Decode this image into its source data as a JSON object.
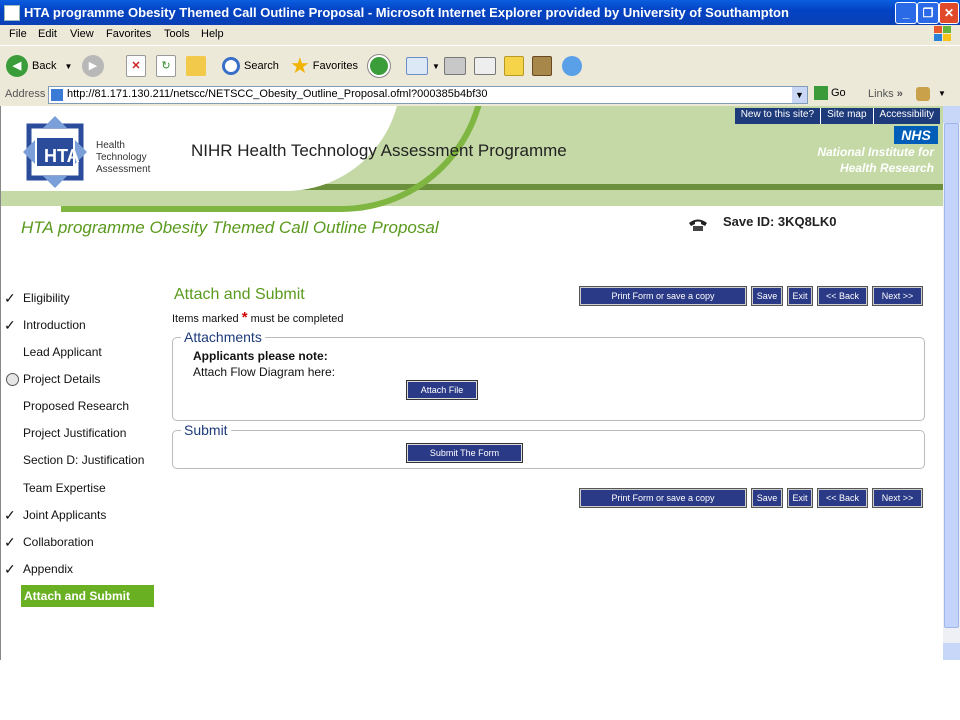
{
  "window": {
    "title": "HTA programme Obesity Themed Call Outline Proposal - Microsoft Internet Explorer provided by University of Southampton",
    "controls": {
      "minimize": "_",
      "maximize": "❐",
      "close": "✕"
    }
  },
  "menu": [
    "File",
    "Edit",
    "View",
    "Favorites",
    "Tools",
    "Help"
  ],
  "toolbar": {
    "back": "Back",
    "search": "Search",
    "favorites": "Favorites"
  },
  "address": {
    "label": "Address",
    "url": "http://81.171.130.211/netscc/NETSCC_Obesity_Outline_Proposal.ofml?000385b4bf30",
    "go": "Go",
    "links": "Links"
  },
  "banner": {
    "hta_logo_text": "HTA",
    "hta_line1": "Health",
    "hta_line2": "Technology",
    "hta_line3": "Assessment",
    "programme_title": "NIHR Health Technology Assessment Programme",
    "top_links": [
      "New to this site?",
      "Site map",
      "Accessibility"
    ],
    "nhs": "NHS",
    "nihr_line1": "National Institute for",
    "nihr_line2": "Health Research"
  },
  "page": {
    "proposal_title": "HTA programme Obesity Themed Call Outline Proposal",
    "save_id": "Save ID: 3KQ8LK0"
  },
  "nav": [
    {
      "label": "Eligibility",
      "status": "complete",
      "mark": "✓"
    },
    {
      "label": "Introduction",
      "status": "complete",
      "mark": "✓"
    },
    {
      "label": "Lead Applicant",
      "status": "none",
      "mark": ""
    },
    {
      "label": "Project Details",
      "status": "in-progress",
      "mark": ""
    },
    {
      "label": "Proposed Research",
      "status": "none",
      "mark": ""
    },
    {
      "label": "Project Justification",
      "status": "none",
      "mark": ""
    },
    {
      "label": "Section D: Justification",
      "status": "none",
      "mark": ""
    },
    {
      "label": "Team Expertise",
      "status": "none",
      "mark": ""
    },
    {
      "label": "Joint Applicants",
      "status": "complete",
      "mark": "✓"
    },
    {
      "label": "Collaboration",
      "status": "complete",
      "mark": "✓"
    },
    {
      "label": "Appendix",
      "status": "complete",
      "mark": "✓"
    },
    {
      "label": "Attach and Submit",
      "status": "active",
      "mark": ""
    }
  ],
  "main": {
    "section_title": "Attach and Submit",
    "required_prefix": "Items marked",
    "required_star": "*",
    "required_suffix": "must be completed",
    "buttons": {
      "print": "Print Form or save a copy",
      "save": "Save",
      "exit": "Exit",
      "back": "<< Back",
      "next": "Next >>"
    },
    "attachments": {
      "legend": "Attachments",
      "note": "Applicants please note:",
      "flow_label": "Attach Flow Diagram here:",
      "attach_button": "Attach File"
    },
    "submit": {
      "legend": "Submit",
      "submit_button": "Submit The Form"
    }
  },
  "colors": {
    "accent_green": "#5a9a1e",
    "nav_active": "#6ab023",
    "button_blue": "#2a3a86",
    "xp_title": "#0a5fe0"
  }
}
